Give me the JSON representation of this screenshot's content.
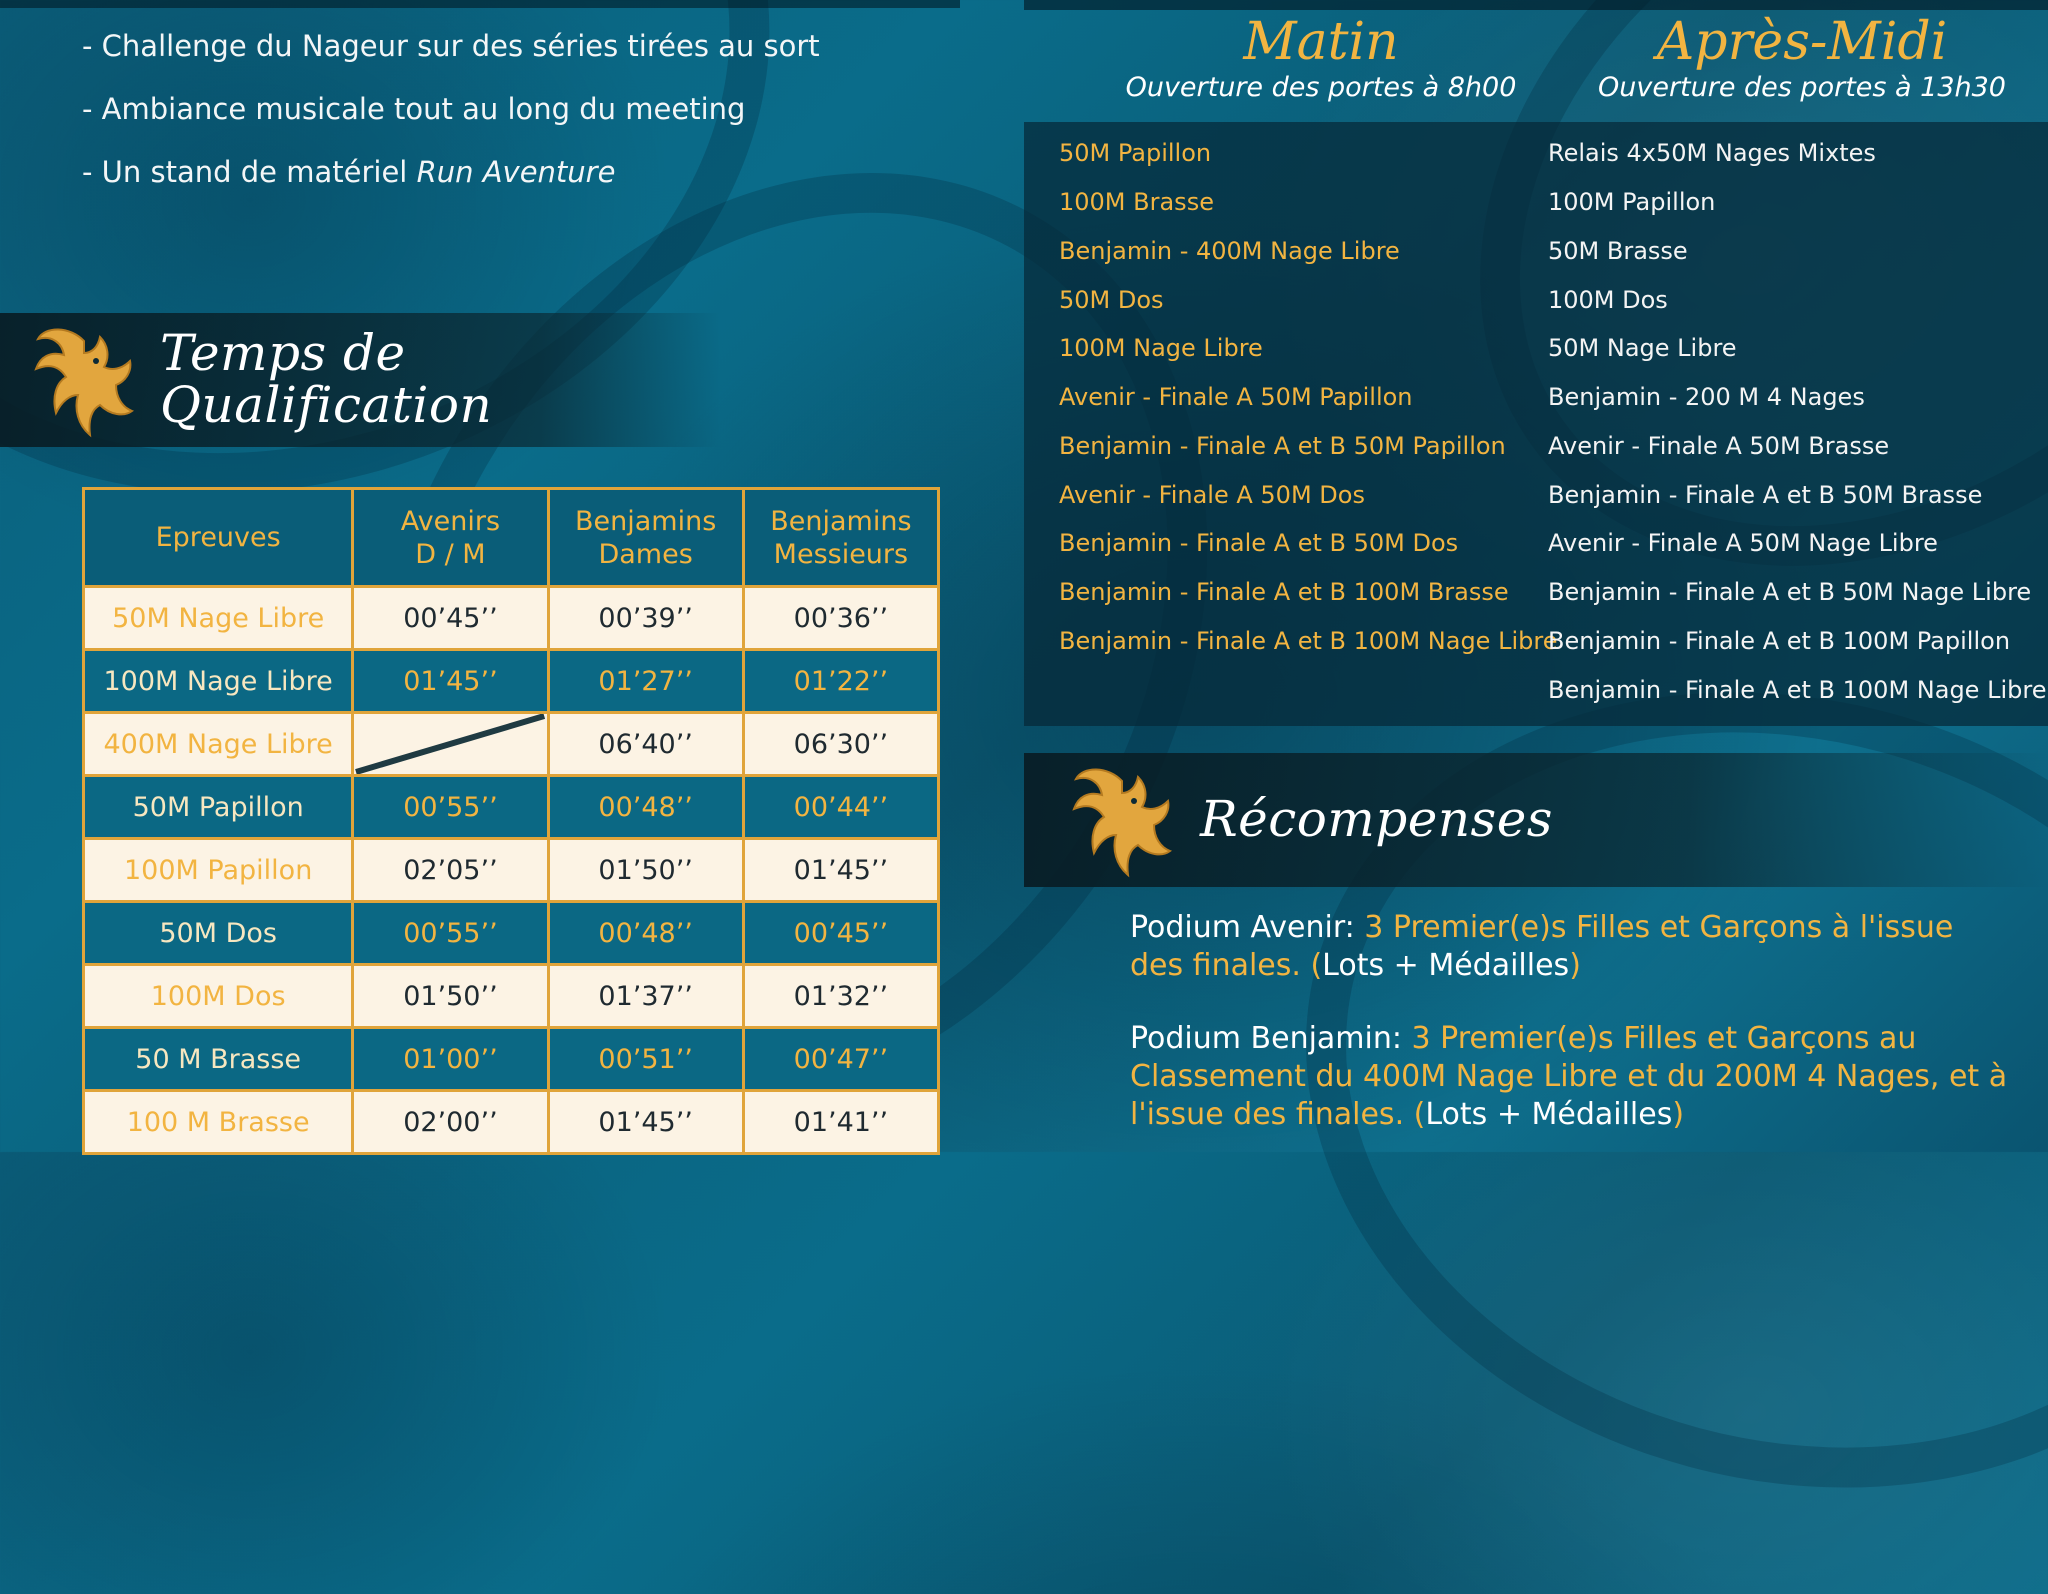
{
  "activities": [
    "- Challenge du Nageur sur des séries tirées au sort",
    "- Ambiance musicale tout au long du meeting"
  ],
  "activity_stand_prefix": "- Un stand de matériel ",
  "activity_stand_brand": "Run Aventure",
  "qualification": {
    "title_line1": "Temps de",
    "title_line2": "Qualification",
    "headers": [
      "Epreuves",
      "Avenirs\nD / M",
      "Benjamins\nDames",
      "Benjamins\nMessieurs"
    ],
    "rows": [
      {
        "event": "50M Nage Libre",
        "avenirs": "00’45’’",
        "benj_dames": "00’39’’",
        "benj_messieurs": "00’36’’"
      },
      {
        "event": "100M Nage Libre",
        "avenirs": "01’45’’",
        "benj_dames": "01’27’’",
        "benj_messieurs": "01’22’’"
      },
      {
        "event": "400M Nage Libre",
        "avenirs": "",
        "benj_dames": "06’40’’",
        "benj_messieurs": "06’30’’"
      },
      {
        "event": "50M Papillon",
        "avenirs": "00’55’’",
        "benj_dames": "00’48’’",
        "benj_messieurs": "00’44’’"
      },
      {
        "event": "100M Papillon",
        "avenirs": "02’05’’",
        "benj_dames": "01’50’’",
        "benj_messieurs": "01’45’’"
      },
      {
        "event": "50M Dos",
        "avenirs": "00’55’’",
        "benj_dames": "00’48’’",
        "benj_messieurs": "00’45’’"
      },
      {
        "event": "100M Dos",
        "avenirs": "01’50’’",
        "benj_dames": "01’37’’",
        "benj_messieurs": "01’32’’"
      },
      {
        "event": "50 M Brasse",
        "avenirs": "01’00’’",
        "benj_dames": "00’51’’",
        "benj_messieurs": "00’47’’"
      },
      {
        "event": "100 M Brasse",
        "avenirs": "02’00’’",
        "benj_dames": "01’45’’",
        "benj_messieurs": "01’41’’"
      }
    ]
  },
  "schedule": {
    "morning_title": "Matin",
    "morning_subtitle": "Ouverture des portes à 8h00",
    "afternoon_title": "Après-Midi",
    "afternoon_subtitle": "Ouverture des portes à 13h30",
    "morning": [
      "50M Papillon",
      "100M Brasse",
      "Benjamin - 400M Nage Libre",
      "50M Dos",
      "100M Nage Libre",
      "Avenir - Finale A 50M Papillon",
      "Benjamin - Finale A et B 50M Papillon",
      "Avenir - Finale A 50M Dos",
      "Benjamin - Finale A et B 50M Dos",
      "Benjamin - Finale A et B 100M Brasse",
      "Benjamin - Finale A et B 100M Nage Libre"
    ],
    "afternoon": [
      "Relais 4x50M Nages Mixtes",
      "100M Papillon",
      "50M Brasse",
      "100M Dos",
      "50M Nage Libre",
      "Benjamin - 200 M 4 Nages",
      "Avenir - Finale A 50M Brasse",
      "Benjamin - Finale A et B 50M Brasse",
      "Avenir - Finale A 50M Nage Libre",
      "Benjamin - Finale A et B 50M Nage Libre",
      "Benjamin - Finale A et B 100M  Papillon",
      "Benjamin - Finale A et B 100M Nage Libre"
    ]
  },
  "rewards": {
    "title": "Récompenses",
    "avenir_label": "Podium Avenir:",
    "avenir_text": " 3 Premier(e)s Filles et Garçons à l'issue des finales. (",
    "avenir_lots": "Lots + Médailles",
    "avenir_close": ")",
    "benjamin_label": "Podium Benjamin:",
    "benjamin_text": " 3 Premier(e)s Filles et Garçons au Classement du 400M Nage Libre et du 200M 4 Nages, et à l'issue des finales. (",
    "benjamin_lots": "Lots + Médailles",
    "benjamin_close": ")"
  },
  "colors": {
    "gold": "#f2b441",
    "teal": "#0b6884",
    "cream": "#fcf3e4",
    "dark_panel": "#082a37"
  },
  "icons": [
    "griffin-emblem-icon",
    "griffin-emblem-icon"
  ]
}
